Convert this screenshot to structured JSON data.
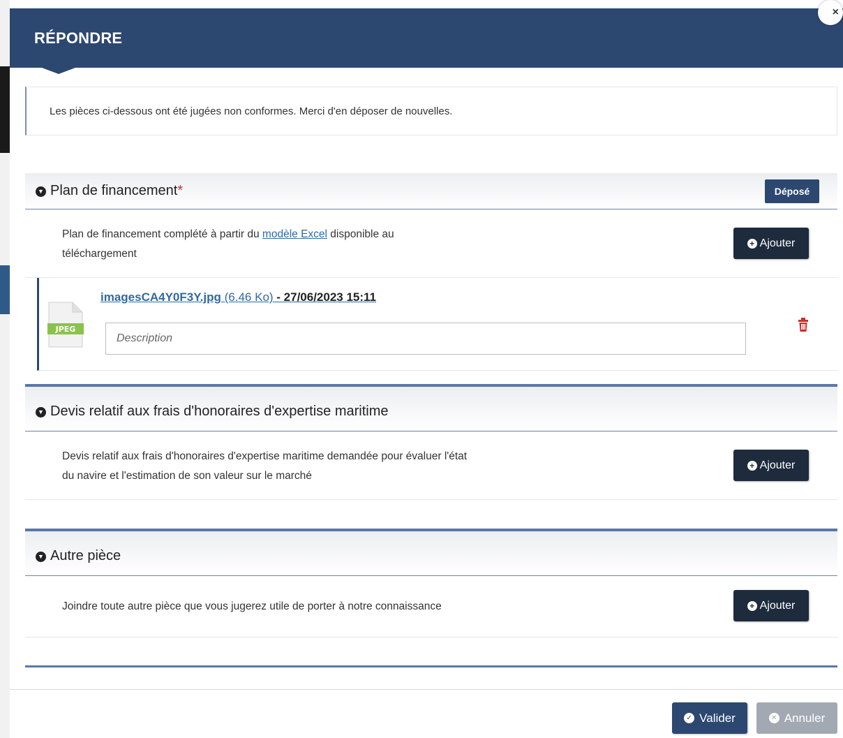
{
  "modal": {
    "title": "RÉPONDRE",
    "close_icon": "×"
  },
  "notice": {
    "text": "Les pièces ci-dessous ont été jugées non conformes. Merci d'en déposer de nouvelles."
  },
  "sections": [
    {
      "title": "Plan de financement",
      "required_mark": "*",
      "status_badge": "Déposé",
      "description_before_link": "Plan de financement complété à partir du ",
      "description_link": "modèle Excel",
      "description_after_link": " disponible au",
      "description_line2": "téléchargement",
      "add_label": "Ajouter",
      "file": {
        "type_label": "JPEG",
        "name": "imagesCA4Y0F3Y.jpg",
        "size": " (6.46 Ko) ",
        "date": "- 27/06/2023 15:11",
        "description_placeholder": "Description"
      }
    },
    {
      "title": "Devis relatif aux frais d'honoraires d'expertise maritime",
      "description_line1": "Devis relatif aux frais d'honoraires d'expertise maritime demandée pour évaluer l'état",
      "description_line2": "du navire et l'estimation de son valeur sur le marché",
      "add_label": "Ajouter"
    },
    {
      "title": "Autre pièce",
      "description_line1": "Joindre toute autre pièce que vous jugerez utile de porter à notre connaissance",
      "add_label": "Ajouter"
    }
  ],
  "footer": {
    "validate_label": "Valider",
    "cancel_label": "Annuler"
  },
  "colors": {
    "header_bg": "#2c4770",
    "button_dark": "#1d2b3d",
    "link": "#2f6aa3",
    "required": "#c9302c",
    "delete_icon": "#c9302c",
    "cancel_bg": "#a3a9b3"
  },
  "icons": {
    "section_toggle": "chevron-circle-down-icon",
    "add": "plus-circle-icon",
    "delete": "trash-icon",
    "validate": "check-circle-icon",
    "cancel": "times-circle-icon",
    "file": "jpeg-file-icon"
  }
}
